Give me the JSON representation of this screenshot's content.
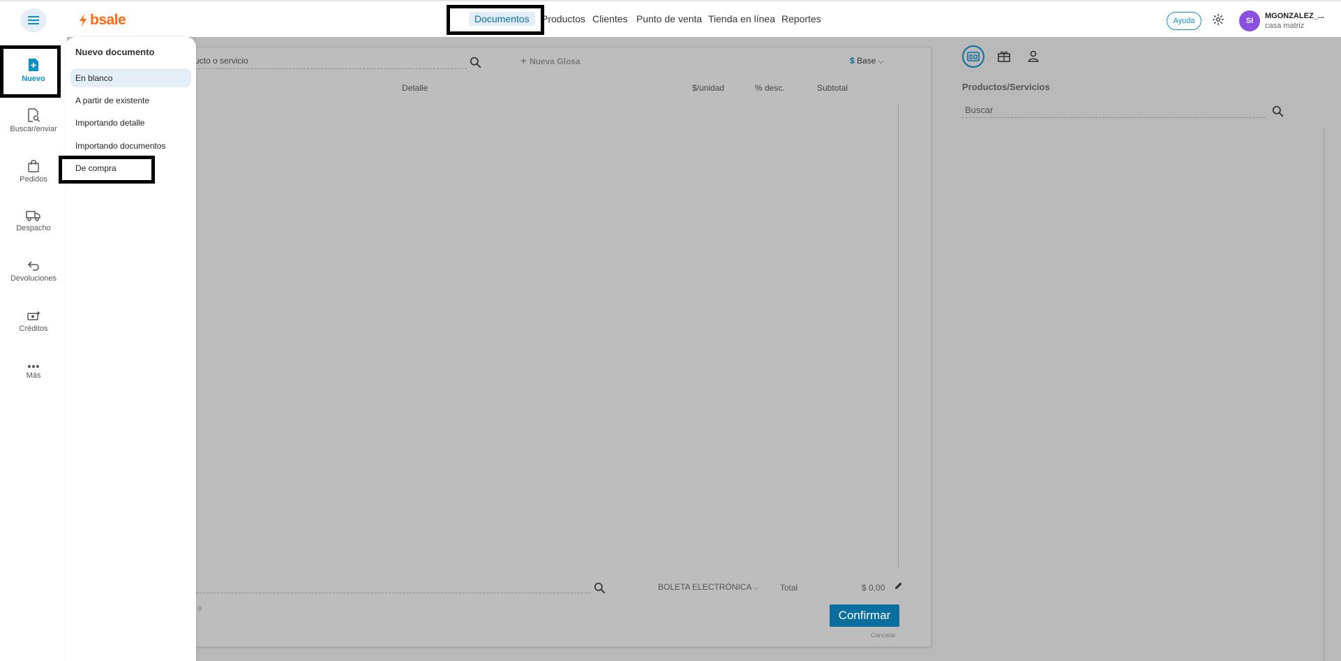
{
  "header": {
    "brand": "bsale",
    "nav": [
      "Documentos",
      "Productos",
      "Clientes",
      "Punto de venta",
      "Tienda en línea",
      "Reportes"
    ],
    "active_nav": "Documentos",
    "help_label": "Ayuda",
    "user_initials": "SI",
    "user_name": "MGONZALEZ_...",
    "user_branch": "casa matriz"
  },
  "sidebar": {
    "items": [
      {
        "label": "Nuevo",
        "icon": "new-document-icon"
      },
      {
        "label": "Buscar/enviar",
        "icon": "search-document-icon"
      },
      {
        "label": "Pedidos",
        "icon": "shopping-bag-icon"
      },
      {
        "label": "Despacho",
        "icon": "truck-icon"
      },
      {
        "label": "Devoluciones",
        "icon": "return-arrow-icon"
      },
      {
        "label": "Créditos",
        "icon": "money-icon"
      },
      {
        "label": "Más",
        "icon": "more-dots-icon"
      }
    ]
  },
  "dropdown": {
    "title": "Nuevo documento",
    "items": [
      "En blanco",
      "A partir de existente",
      "Importando detalle",
      "Importando documentos",
      "De compra"
    ]
  },
  "document": {
    "search_placeholder": "ucto o servicio",
    "new_gloss": "Nueva Glosa",
    "price_list_symbol": "$",
    "price_list": "Base",
    "columns": [
      "Detalle",
      "$/unidad",
      "% desc.",
      "Subtotal"
    ],
    "doc_type": "BOLETA ELECTRÓNICA",
    "total_label": "Total",
    "total_value": "$ 0,00",
    "small_counter": ": 0",
    "confirm": "Confirmar",
    "cancel": "Cancelar"
  },
  "products_panel": {
    "title": "Productos/Servicios",
    "search_placeholder": "Buscar"
  }
}
